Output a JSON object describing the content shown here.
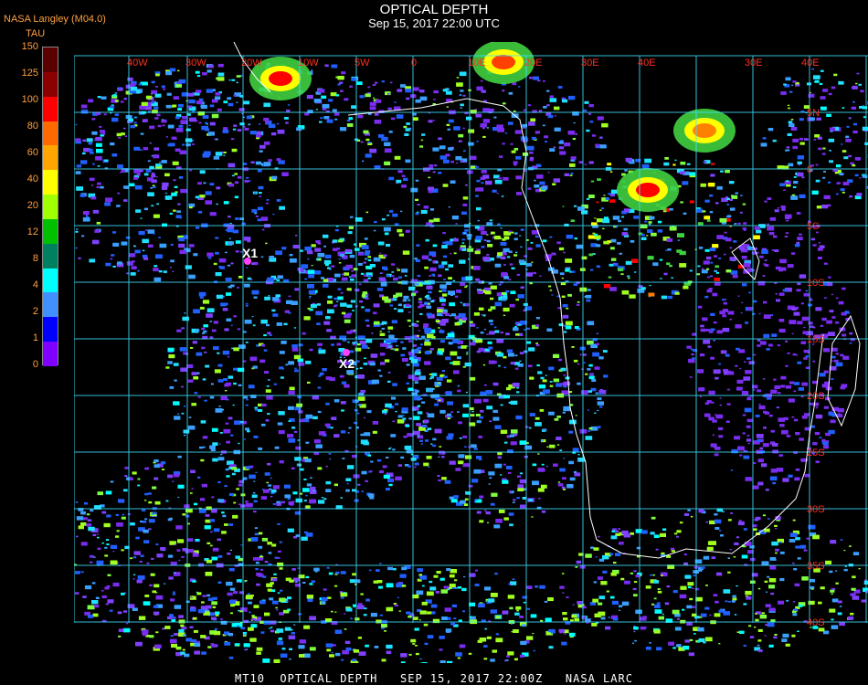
{
  "header": {
    "org_label": "NASA Langley (M04.0)",
    "title": "OPTICAL DEPTH",
    "subtitle": "Sep 15, 2017 22:00 UTC"
  },
  "colorbar": {
    "title": "TAU",
    "ticks": [
      "150",
      "125",
      "100",
      "80",
      "60",
      "40",
      "20",
      "12",
      "8",
      "4",
      "2",
      "1",
      "0"
    ],
    "colors": [
      "#5a0000",
      "#8b0000",
      "#ff0000",
      "#ff6a00",
      "#ffa500",
      "#ffff00",
      "#a0ff00",
      "#00c000",
      "#008060",
      "#00ffff",
      "#4090ff",
      "#0000ff",
      "#8000ff"
    ]
  },
  "map": {
    "lon_labels": [
      "40W",
      "30W",
      "20W",
      "10W",
      "5W",
      "0",
      "10E",
      "20E",
      "30E",
      "40E",
      "30E",
      "40E"
    ],
    "lat_labels": [
      "5N",
      "0",
      "5S",
      "10S",
      "15S",
      "20S",
      "25S",
      "30S",
      "35S",
      "40S"
    ],
    "markers": [
      {
        "label": "X1"
      },
      {
        "label": "X2"
      }
    ],
    "grid_color": "#40e0ff",
    "coast_color": "#ffffff"
  },
  "footer": {
    "text": "MT10  OPTICAL DEPTH   SEP 15, 2017 22:00Z   NASA LARC"
  }
}
